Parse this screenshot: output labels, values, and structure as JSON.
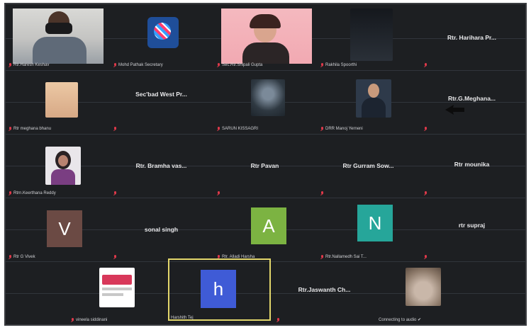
{
  "gallery": {
    "row1": {
      "t1": "Rtr.Haresh Keshav",
      "t2": "Mohd Pathak Secretary",
      "t3": "Sec.Rtr.Shipali Gupta",
      "t4": "Rakhila Spoorthi",
      "t5": "Rtr. Harihara Pr..."
    },
    "row2": {
      "t1": "Rtr meghana bhanu",
      "t2": "Sec'bad West Pr...",
      "t3": "SARUN KISSAGRI",
      "t4": "DRR Manoj Yerneni",
      "t5": "Rtr.G.Meghana..."
    },
    "row3": {
      "t1": "Rtrn.Keerthana Reddy",
      "t2": "Rtr. Bramha vas...",
      "t3": "Rtr Pavan",
      "t4": "Rtr Gurram Sow...",
      "t5": "Rtr mounika"
    },
    "row4": {
      "t1": "Rtr G Vivek",
      "t2": "sonal singh",
      "t3": "Rtr. Alladi Harsha",
      "t4": "Rtr.Nallamedh Sai T...",
      "t5": "rtr supraj"
    },
    "row5": {
      "t1": "vineela siddinani",
      "t2": "Harshith Tej",
      "t3": "Rtr.Jaswanth Ch...",
      "t4": "Connecting to audio ✔"
    },
    "avatars": {
      "r4t1": "V",
      "r4t3": "A",
      "r4t4": "N",
      "r5t2": "h"
    },
    "colors": {
      "avatar_v": "#6b4a44",
      "avatar_a": "#7cb342",
      "avatar_n": "#26a69a",
      "avatar_h": "#3f5bd6",
      "active_border": "#e2d66b",
      "muted": "#e0394a"
    }
  }
}
